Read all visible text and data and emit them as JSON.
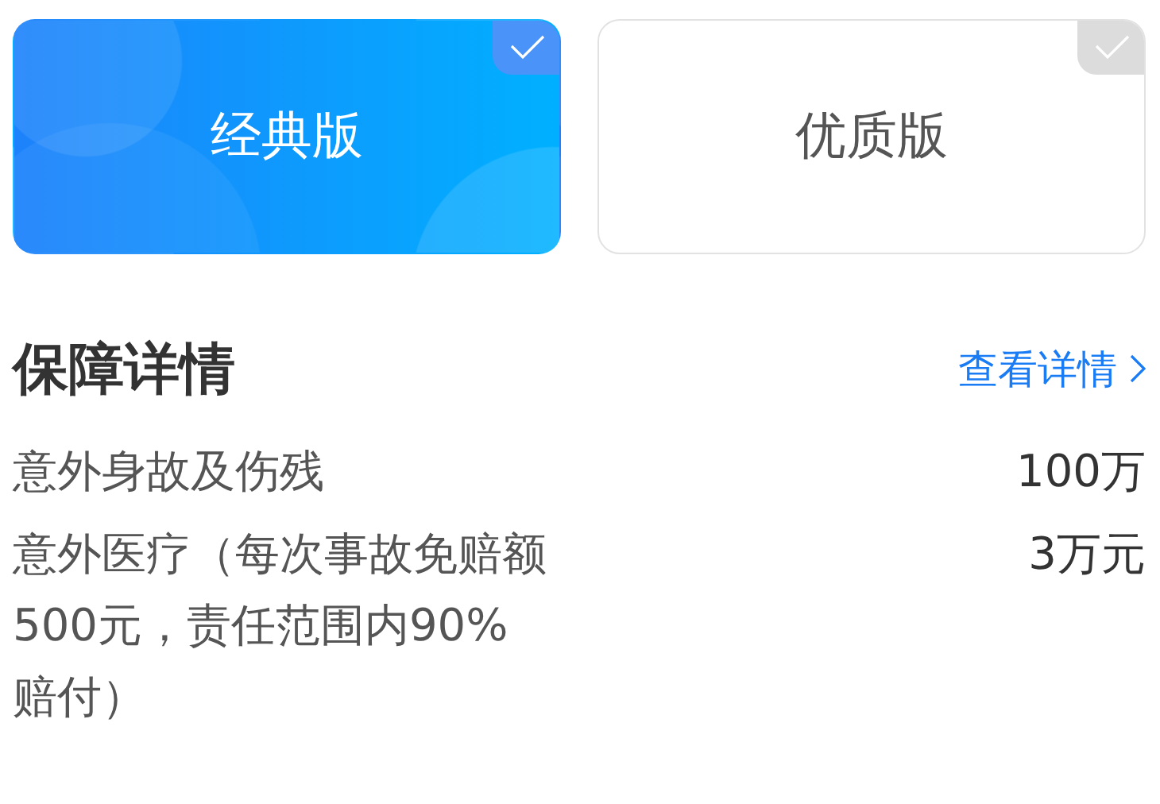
{
  "plans": [
    {
      "label": "经典版",
      "selected": true
    },
    {
      "label": "优质版",
      "selected": false
    }
  ],
  "coverage": {
    "title": "保障详情",
    "link": "查看详情",
    "items": [
      {
        "name": "意外身故及伤残",
        "amount": "100万"
      },
      {
        "name": "意外医疗（每次事故免赔额500元，责任范围内90%赔付）",
        "amount": "3万元"
      }
    ]
  }
}
